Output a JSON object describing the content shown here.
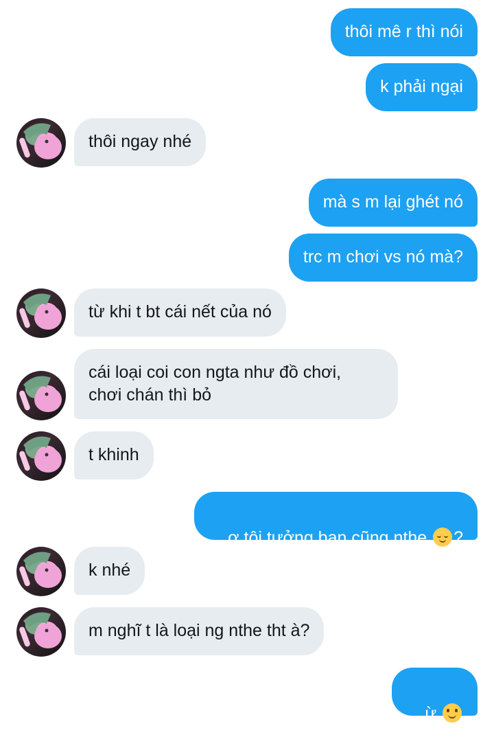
{
  "messages": [
    {
      "sender": "me",
      "text": "thôi mê r thì nói"
    },
    {
      "sender": "me",
      "text": "k phải ngại"
    },
    {
      "sender": "them",
      "text": "thôi ngay nhé"
    },
    {
      "sender": "me",
      "text": "mà s m lại ghét nó"
    },
    {
      "sender": "me",
      "text": "trc m chơi vs nó mà?"
    },
    {
      "sender": "them",
      "text": "từ khi t bt cái nết của nó"
    },
    {
      "sender": "them",
      "text": "cái loại coi con ngta như đồ chơi,\nchơi chán thì bỏ"
    },
    {
      "sender": "them",
      "text": "t khinh"
    },
    {
      "sender": "me",
      "text": "ơ tôi tưởng bạn cũng nthe ",
      "emoji": "relieved-face-icon",
      "suffix": "?"
    },
    {
      "sender": "them",
      "text": "k nhé"
    },
    {
      "sender": "them",
      "text": "m nghĩ t là loại ng nthe tht à?"
    },
    {
      "sender": "me",
      "text": "ừ ",
      "emoji": "slightly-smiling-face-icon",
      "suffix": ""
    }
  ],
  "colors": {
    "outgoing_bubble": "#1da1f2",
    "incoming_bubble": "#e6ecf0",
    "outgoing_text": "#ffffff",
    "incoming_text": "#14171a"
  }
}
